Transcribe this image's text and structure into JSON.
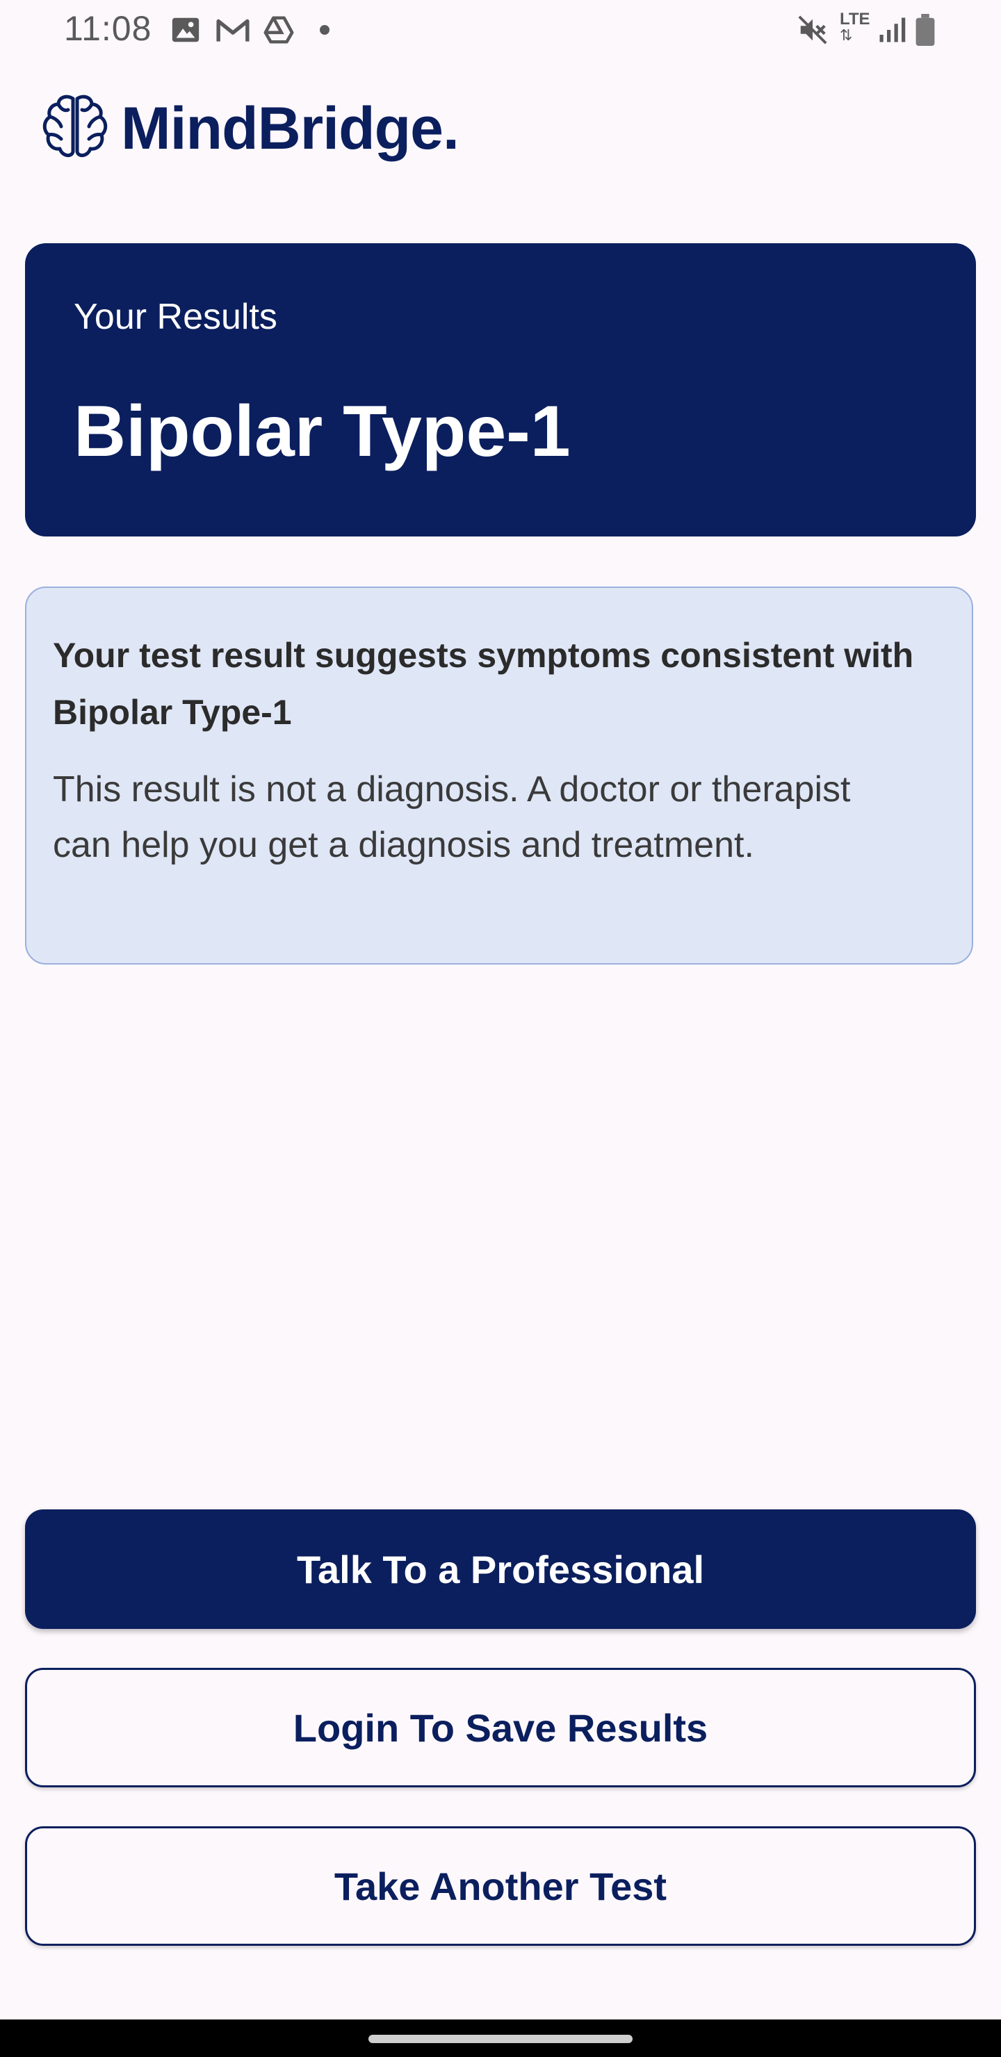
{
  "status_bar": {
    "time": "11:08",
    "network": "LTE"
  },
  "app": {
    "name": "MindBridge."
  },
  "results": {
    "label": "Your Results",
    "value": "Bipolar Type-1"
  },
  "info": {
    "title": "Your test result suggests symptoms consistent with Bipolar Type-1",
    "body": "This result is not a diagnosis. A doctor or therapist can help you get a diagnosis and treatment."
  },
  "buttons": {
    "talk": "Talk To a Professional",
    "login": "Login To Save Results",
    "another": "Take Another Test"
  },
  "colors": {
    "brand": "#0b1f5e",
    "info_background": "#dfe6f6",
    "info_border": "#9bb0dd",
    "page_background": "#fdf8fc"
  },
  "icons": [
    "image-icon",
    "gmail-icon",
    "drive-icon",
    "mute-icon",
    "lte-icon",
    "signal-icon",
    "battery-icon",
    "brain-icon"
  ]
}
